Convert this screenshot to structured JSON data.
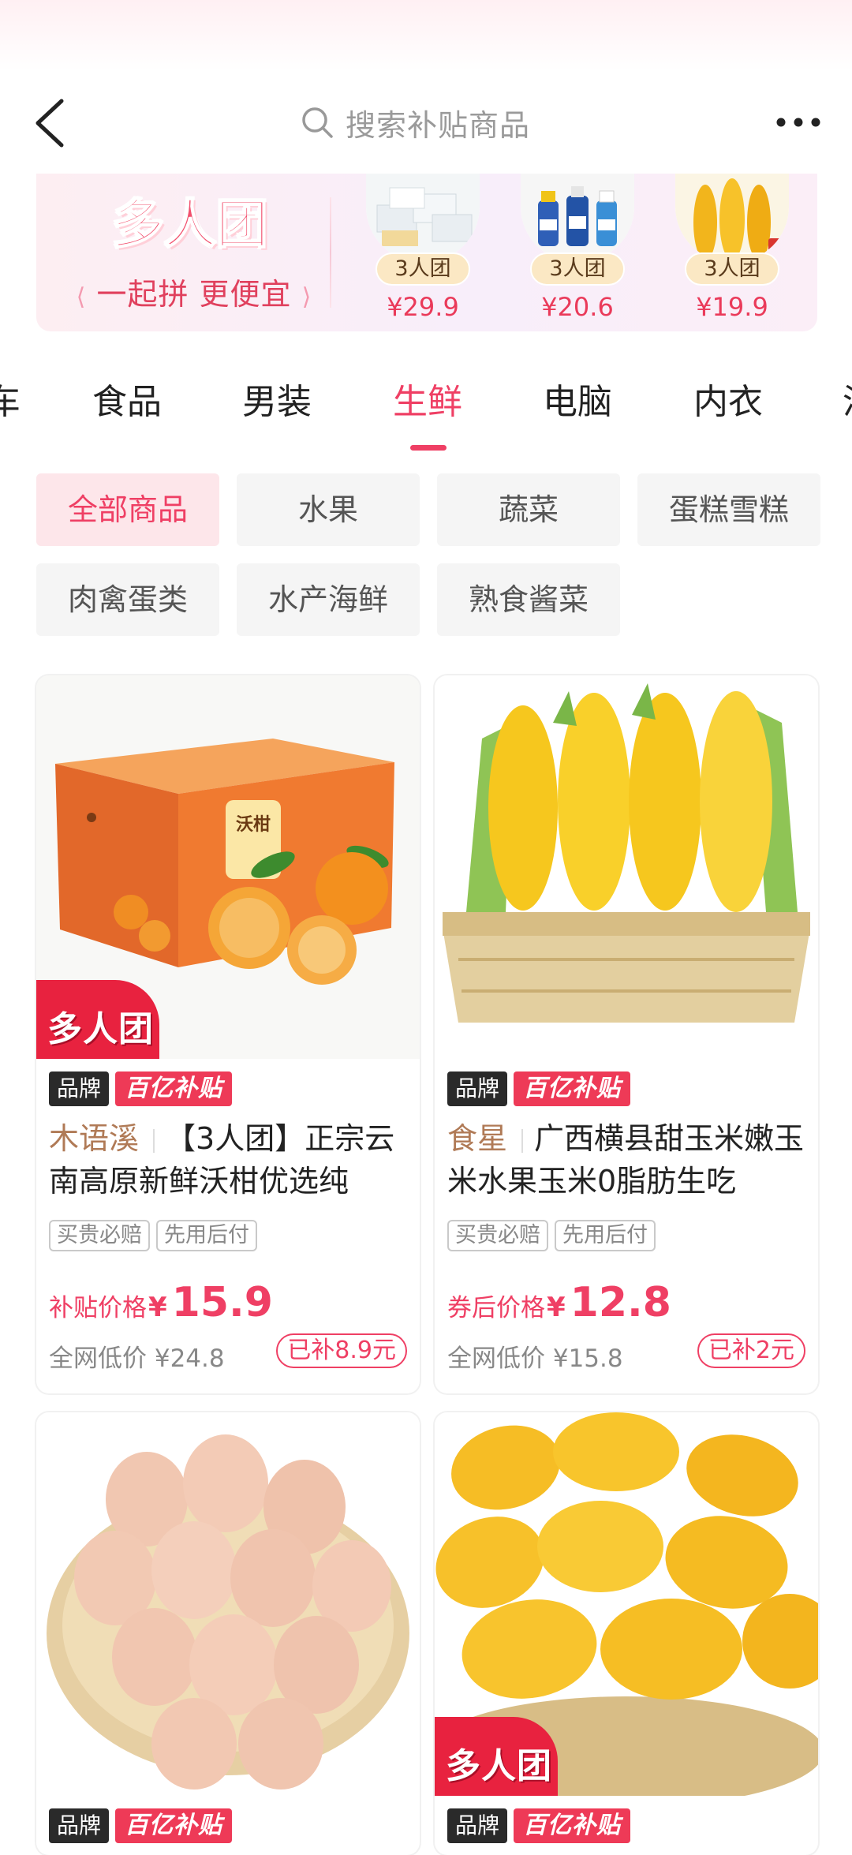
{
  "header": {
    "search_placeholder": "搜索补贴商品"
  },
  "banner": {
    "logo_text": "多人团",
    "slogan": "一起拼 更便宜",
    "items": [
      {
        "tag": "3人团",
        "price": "¥29.9"
      },
      {
        "tag": "3人团",
        "price": "¥20.6"
      },
      {
        "tag": "3人团",
        "price": "¥19.9"
      }
    ]
  },
  "tabs": [
    {
      "label": "车"
    },
    {
      "label": "食品"
    },
    {
      "label": "男装"
    },
    {
      "label": "生鲜"
    },
    {
      "label": "电脑"
    },
    {
      "label": "内衣"
    },
    {
      "label": "汽"
    }
  ],
  "active_tab": "生鲜",
  "subcategories": [
    {
      "label": "全部商品"
    },
    {
      "label": "水果"
    },
    {
      "label": "蔬菜"
    },
    {
      "label": "蛋糕雪糕"
    },
    {
      "label": "肉禽蛋类"
    },
    {
      "label": "水产海鲜"
    },
    {
      "label": "熟食酱菜"
    }
  ],
  "products": [
    {
      "group_badge": "多人团",
      "brand_badge": "品牌",
      "subsidy_badge": "百亿补贴",
      "brand": "木语溪",
      "title": "【3人团】正宗云南高原新鲜沃柑优选纯",
      "services": [
        "买贵必赔",
        "先用后付"
      ],
      "price_label": "补贴价格",
      "currency": "¥",
      "price": "15.9",
      "ref_price": "全网低价 ¥24.8",
      "saved": "已补8.9元",
      "box_label": "沃柑"
    },
    {
      "brand_badge": "品牌",
      "subsidy_badge": "百亿补贴",
      "brand": "食星",
      "title": "广西横县甜玉米嫩玉米水果玉米0脂肪生吃",
      "services": [
        "买贵必赔",
        "先用后付"
      ],
      "price_label": "券后价格",
      "currency": "¥",
      "price": "12.8",
      "ref_price": "全网低价 ¥15.8",
      "saved": "已补2元"
    },
    {
      "brand_badge": "品牌",
      "subsidy_badge": "百亿补贴"
    },
    {
      "group_badge": "多人团",
      "brand_badge": "品牌",
      "subsidy_badge": "百亿补贴"
    }
  ],
  "colors": {
    "accent": "#ef3f64",
    "subsidy": "#ee3a57",
    "brand_text": "#b07a56"
  }
}
